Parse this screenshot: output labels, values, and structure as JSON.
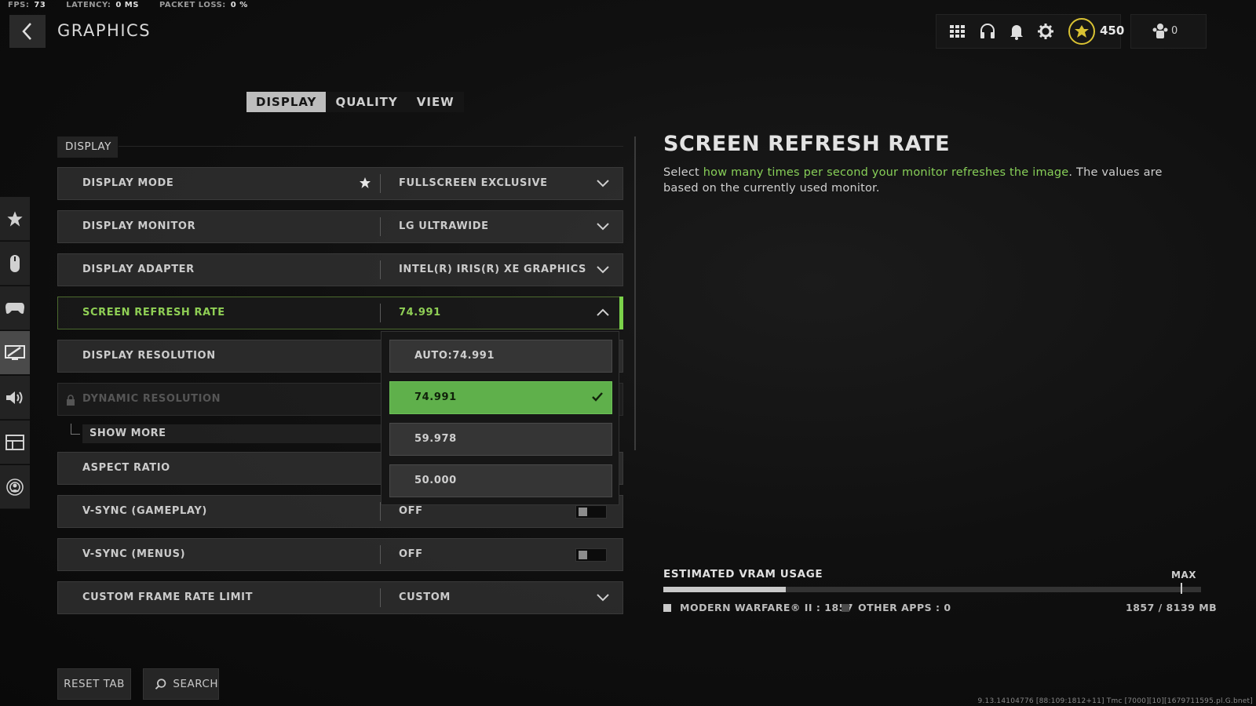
{
  "stats": {
    "fps_label": "FPS:",
    "fps_value": "73",
    "latency_label": "LATENCY:",
    "latency_value": "0 MS",
    "packet_label": "PACKET LOSS:",
    "packet_value": "0 %"
  },
  "header": {
    "title": "GRAPHICS",
    "cod_points": "450",
    "party_count": "0",
    "icons": [
      "grid-icon",
      "headset-icon",
      "bell-icon",
      "gear-icon",
      "cod-points-icon",
      "party-icon"
    ]
  },
  "tabs": [
    {
      "label": "DISPLAY",
      "active": true
    },
    {
      "label": "QUALITY",
      "active": false
    },
    {
      "label": "VIEW",
      "active": false
    }
  ],
  "section": {
    "label": "DISPLAY"
  },
  "settings": [
    {
      "name": "DISPLAY MODE",
      "value": "FULLSCREEN EXCLUSIVE",
      "control": "dropdown",
      "starred": true
    },
    {
      "name": "DISPLAY MONITOR",
      "value": "LG ULTRAWIDE",
      "control": "dropdown"
    },
    {
      "name": "DISPLAY ADAPTER",
      "value": "INTEL(R) IRIS(R) XE GRAPHICS",
      "control": "dropdown"
    },
    {
      "name": "SCREEN REFRESH RATE",
      "value": "74.991",
      "control": "dropdown",
      "expanded": true
    },
    {
      "name": "DISPLAY RESOLUTION",
      "value": "",
      "control": "dropdown"
    },
    {
      "name": "DYNAMIC RESOLUTION",
      "value": "",
      "control": "locked"
    },
    {
      "name": "ASPECT RATIO",
      "value": "",
      "control": "dropdown"
    },
    {
      "name": "V-SYNC (GAMEPLAY)",
      "value": "OFF",
      "control": "toggle"
    },
    {
      "name": "V-SYNC (MENUS)",
      "value": "OFF",
      "control": "toggle"
    },
    {
      "name": "CUSTOM FRAME RATE LIMIT",
      "value": "CUSTOM",
      "control": "dropdown"
    }
  ],
  "show_more": "SHOW MORE",
  "dropdown_options": [
    {
      "label": "AUTO:74.991",
      "selected": false
    },
    {
      "label": "74.991",
      "selected": true
    },
    {
      "label": "59.978",
      "selected": false
    },
    {
      "label": "50.000",
      "selected": false
    }
  ],
  "description": {
    "title": "SCREEN REFRESH RATE",
    "body_prefix": "Select ",
    "body_highlight": "how many times per second your monitor refreshes the image",
    "body_suffix": ". The values are based on the currently used monitor."
  },
  "vram": {
    "title": "ESTIMATED VRAM USAGE",
    "max_label": "MAX",
    "used_fraction": 0.228,
    "legend_game": "MODERN WARFARE® II : 1857",
    "legend_other": "OTHER APPS : 0",
    "total": "1857 / 8139 MB"
  },
  "bottom": {
    "reset_label": "RESET TAB",
    "search_label": "SEARCH"
  },
  "version": "9.13.14104776 [88:109:1812+11] Tmc [7000][10][1679711595.pl.G.bnet]",
  "categories": [
    "star-icon",
    "mouse-icon",
    "controller-icon",
    "graphics-icon",
    "speaker-icon",
    "interface-icon",
    "account-network-icon"
  ],
  "colors": {
    "accent_green": "#7bd24a",
    "selected_option": "#5fb04b",
    "coin_gold": "#d9c233"
  }
}
